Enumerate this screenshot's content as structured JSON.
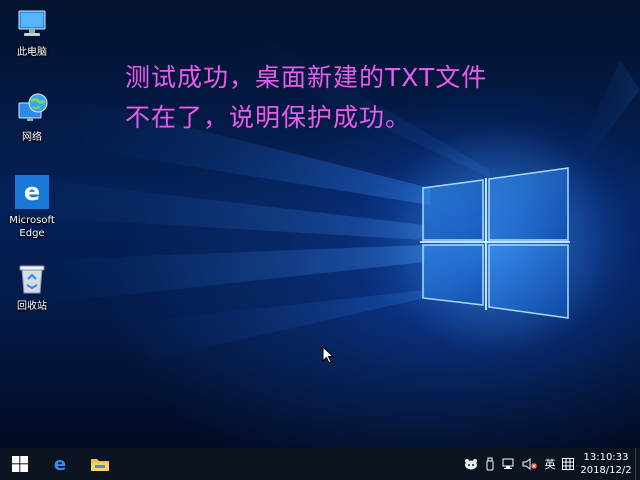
{
  "desktop": {
    "icons": [
      {
        "label": "此电脑",
        "icon": "this-pc-icon"
      },
      {
        "label": "网络",
        "icon": "network-icon"
      },
      {
        "label": "Microsoft\nEdge",
        "icon": "edge-icon"
      },
      {
        "label": "回收站",
        "icon": "recycle-bin-icon"
      }
    ],
    "overlay_text": {
      "line1": "测试成功，桌面新建的TXT文件",
      "line2": "不在了，说明保护成功。"
    }
  },
  "taskbar": {
    "pinned": [
      {
        "icon": "windows-start-icon"
      },
      {
        "icon": "edge-icon"
      },
      {
        "icon": "file-explorer-icon"
      }
    ],
    "tray": {
      "ime": "英",
      "icons": [
        "tray-app-icon",
        "usb-icon",
        "network-icon",
        "volume-muted-icon",
        "keyboard-grid-icon"
      ]
    },
    "clock": {
      "time": "13:10:33",
      "date": "2018/12/2"
    }
  },
  "colors": {
    "overlay_text": "#e060e8",
    "taskbar": "#0d1421",
    "accent": "#1a78d8"
  }
}
